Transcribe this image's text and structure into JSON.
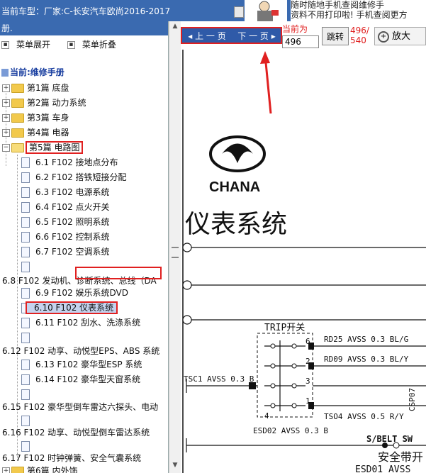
{
  "titlebar": {
    "vehicle_prefix": "当前车型：",
    "vehicle_model": "厂家:C-长安汽车欧尚2016-2017",
    "ad_line1": "随时随地手机查阅维修手",
    "ad_line2": "资料不用打印啦! 手机查阅更方"
  },
  "left": {
    "header": "册.",
    "expand": "菜单展开",
    "collapse": "菜单折叠",
    "current": "当前:维修手册",
    "chapters": [
      "第1篇 底盘",
      "第2篇 动力系统",
      "第3篇 车身",
      "第4篇 电器",
      "第5篇 电路图",
      "第6篇 内外饰"
    ],
    "items": [
      "6.1 F102 接地点分布",
      "6.2 F102 搭铁短接分配",
      "6.3 F102 电源系统",
      "6.4 F102 点火开关",
      "6.5 F102 照明系统",
      "6.6 F102 控制系统",
      "6.7 F102 空调系统",
      "",
      "6.8 F102 发动机、诊断系统、总线（DA",
      "6.9 F102 娱乐系统DVD",
      "6.10 F102 仪表系统",
      "6.11 F102 刮水、洗涤系统",
      "",
      "6.12 F102 动享、动悦型EPS、ABS 系统",
      "6.13 F102 豪华型ESP 系统",
      "6.14 F102 豪华型天窗系统",
      "",
      "6.15 F102 豪华型倒车雷达六探头、电动",
      "",
      "6.16 F102 动享、动悦型倒车雷达系统",
      "",
      "6.17 F102 时钟弹簧、安全气囊系统"
    ]
  },
  "viewer": {
    "prev": "上 一 页",
    "next": "下 一 页",
    "current_label": "当前为",
    "current_page": "496",
    "jump": "跳转",
    "pages_line1": "496/",
    "pages_line2": "540",
    "zoom": "放大"
  },
  "document": {
    "logo_text": "CHANA",
    "section_title": "仪表系统",
    "switch_label": "TRIP开关",
    "wire1": "RD25 AVSS 0.3 BL/G",
    "wire2": "RD09 AVSS 0.3 BL/Y",
    "wire3": "TSC1 AVSS 0.3 B",
    "wire4": "TSO4 AVSS 0.5 R/Y",
    "wire5": "ESD02 AVSS 0.3 B",
    "belt_label": "S/BELT SW",
    "belt_cn": "安全带开",
    "esd_label": "ESD01 AVSS",
    "pin1": "6",
    "pin2": "2",
    "pin3": "3",
    "pin4": "4",
    "pin5": "1",
    "side_label": "CSP07"
  },
  "colors": {
    "header_blue": "#3a6ab0",
    "nav_blue": "#2f5aa8",
    "highlight_red": "#e02020",
    "selected_bg": "#c5d3ee"
  }
}
